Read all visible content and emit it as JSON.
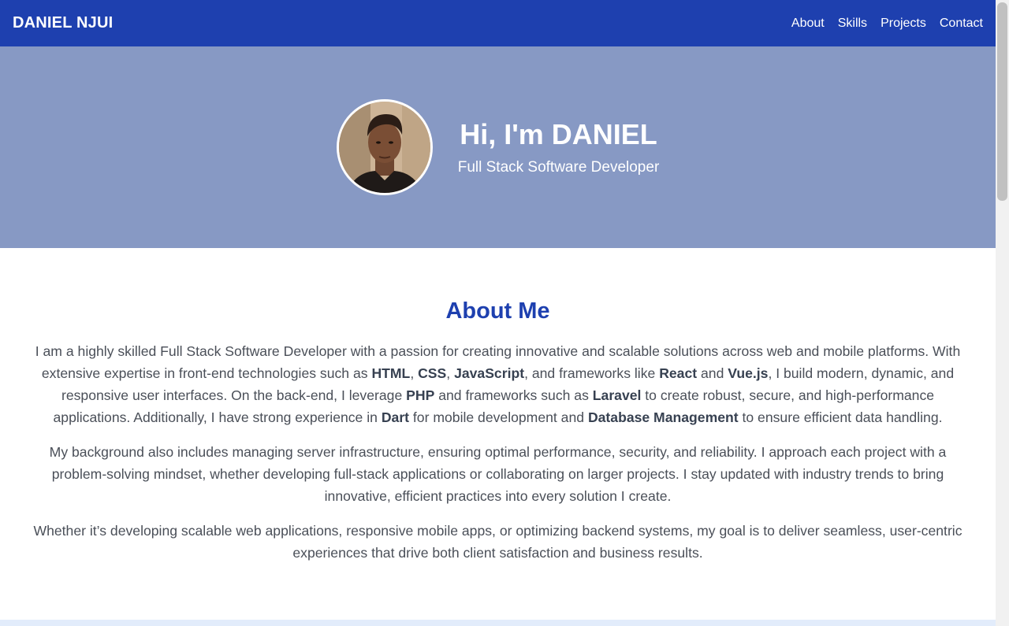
{
  "nav": {
    "brand": "DANIEL NJUI",
    "links": [
      "About",
      "Skills",
      "Projects",
      "Contact"
    ]
  },
  "hero": {
    "title": "Hi, I'm DANIEL",
    "subtitle": "Full Stack Software Developer"
  },
  "about": {
    "title": "About Me",
    "p1": [
      "I am a highly skilled Full Stack Software Developer with a passion for creating innovative and scalable solutions across web and mobile platforms. With extensive expertise in front-end technologies such as ",
      "HTML",
      ", ",
      "CSS",
      ", ",
      "JavaScript",
      ", and frameworks like ",
      "React",
      " and ",
      "Vue.js",
      ", I build modern, dynamic, and responsive user interfaces. On the back-end, I leverage ",
      "PHP",
      " and frameworks such as ",
      "Laravel",
      " to create robust, secure, and high-performance applications. Additionally, I have strong experience in ",
      "Dart",
      " for mobile development and ",
      "Database Management",
      " to ensure efficient data handling."
    ],
    "p2": "My background also includes managing server infrastructure, ensuring optimal performance, security, and reliability. I approach each project with a problem-solving mindset, whether developing full-stack applications or collaborating on larger projects. I stay updated with industry trends to bring innovative, efficient practices into every solution I create.",
    "p3": "Whether it’s developing scalable web applications, responsive mobile apps, or optimizing backend systems, my goal is to deliver seamless, user-centric experiences that drive both client satisfaction and business results."
  },
  "colors": {
    "nav_bg": "#1e40af",
    "hero_bg": "#8799c4",
    "heading": "#1e40af"
  }
}
